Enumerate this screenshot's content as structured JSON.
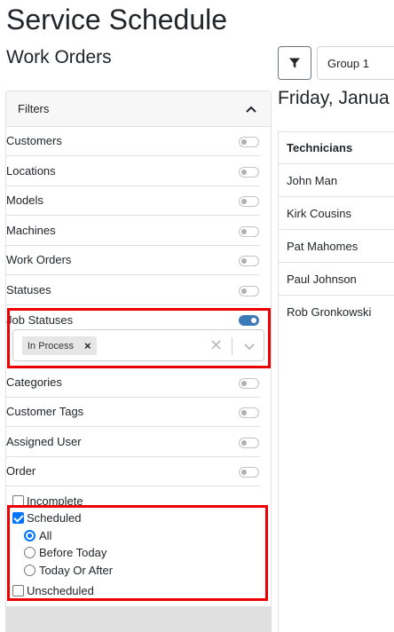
{
  "page": {
    "title": "Service Schedule",
    "subtitle": "Work Orders"
  },
  "toolbar": {
    "filter_icon": "filter-funnel-icon",
    "group_value": "Group 1"
  },
  "schedule": {
    "date_heading": "Friday, Janua",
    "technicians_header": "Technicians",
    "technicians": [
      "John Man",
      "Kirk Cousins",
      "Pat Mahomes",
      "Paul Johnson",
      "Rob Gronkowski"
    ]
  },
  "filters": {
    "header": "Filters",
    "collapse_icon": "chevron-up-icon",
    "items": [
      {
        "label": "Customers",
        "enabled": false
      },
      {
        "label": "Locations",
        "enabled": false
      },
      {
        "label": "Models",
        "enabled": false
      },
      {
        "label": "Machines",
        "enabled": false
      },
      {
        "label": "Work Orders",
        "enabled": false
      },
      {
        "label": "Statuses",
        "enabled": false
      },
      {
        "label": "Job Statuses",
        "enabled": true
      },
      {
        "label": "Categories",
        "enabled": false
      },
      {
        "label": "Customer Tags",
        "enabled": false
      },
      {
        "label": "Assigned User",
        "enabled": false
      },
      {
        "label": "Order",
        "enabled": false
      }
    ],
    "job_status_selected": "In Process",
    "remove_chip": "×",
    "clear_glyph": "✕",
    "incomplete_label": "Incomplete",
    "incomplete_checked": false,
    "scheduled_label": "Scheduled",
    "scheduled_checked": true,
    "schedule_options": [
      "All",
      "Before Today",
      "Today Or After"
    ],
    "schedule_selected": "All",
    "unscheduled_label": "Unscheduled",
    "unscheduled_checked": false
  },
  "colors": {
    "highlight": "#ee0000",
    "toggle_on": "#3d7ab8",
    "check": "#0075ff"
  }
}
